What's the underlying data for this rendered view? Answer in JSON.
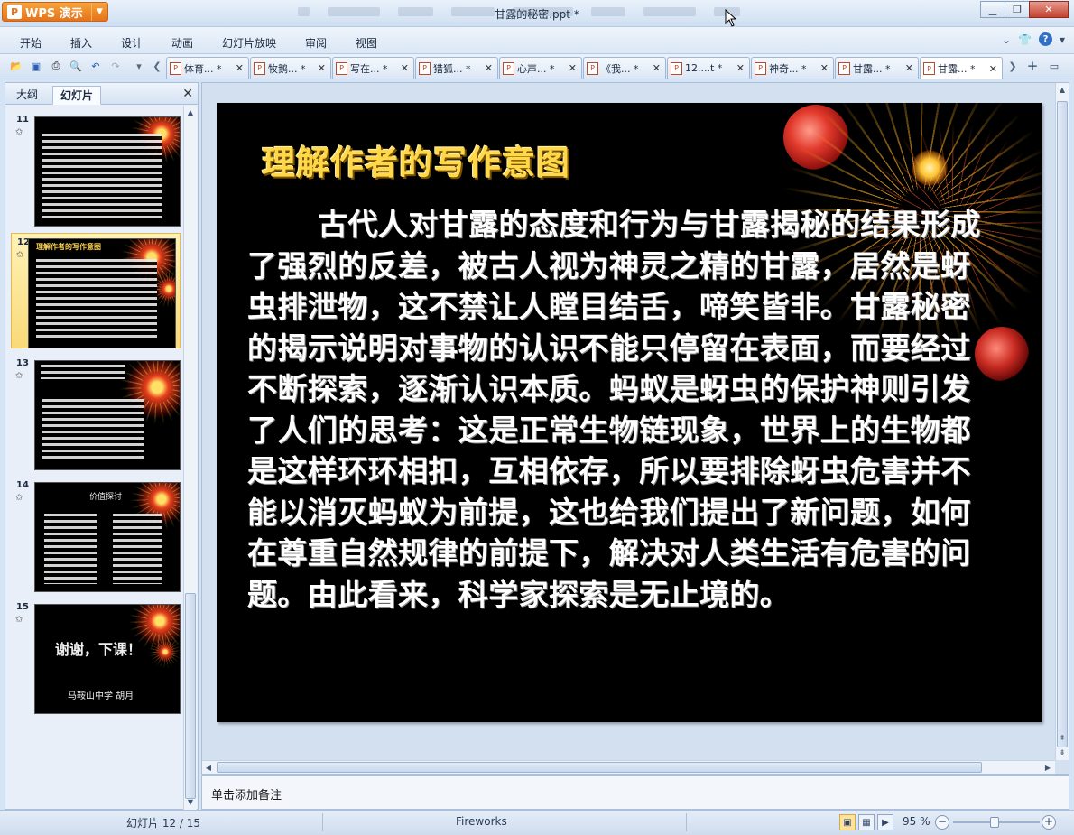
{
  "app": {
    "button_label": "WPS 演示",
    "window_title": "甘露的秘密.ppt *"
  },
  "menu": [
    {
      "label": "开始"
    },
    {
      "label": "插入"
    },
    {
      "label": "设计"
    },
    {
      "label": "动画"
    },
    {
      "label": "幻灯片放映"
    },
    {
      "label": "审阅"
    },
    {
      "label": "视图"
    }
  ],
  "tabs": [
    {
      "label": "体育... *",
      "active": false
    },
    {
      "label": "牧鹅... *",
      "active": false
    },
    {
      "label": "写在... *",
      "active": false
    },
    {
      "label": "猎狐... *",
      "active": false
    },
    {
      "label": "心声... *",
      "active": false
    },
    {
      "label": "《我... *",
      "active": false
    },
    {
      "label": "12....t *",
      "active": false
    },
    {
      "label": "神奇... *",
      "active": false
    },
    {
      "label": "甘露... *",
      "active": false
    },
    {
      "label": "甘露... *",
      "active": true
    }
  ],
  "left_panel": {
    "tabs": [
      {
        "label": "大纲",
        "active": false
      },
      {
        "label": "幻灯片",
        "active": true
      }
    ],
    "slides": [
      {
        "number": "11",
        "selected": false,
        "title": "",
        "labels": []
      },
      {
        "number": "12",
        "selected": true,
        "title": "理解作者的写作意图",
        "labels": []
      },
      {
        "number": "13",
        "selected": false,
        "title": "",
        "labels": []
      },
      {
        "number": "14",
        "selected": false,
        "title": "价值探讨",
        "labels": []
      },
      {
        "number": "15",
        "selected": false,
        "title": "谢谢，下课！",
        "labels": [
          "马鞍山中学 胡月"
        ]
      }
    ]
  },
  "slide": {
    "title": "理解作者的写作意图",
    "body": "古代人对甘露的态度和行为与甘露揭秘的结果形成了强烈的反差，被古人视为神灵之精的甘露，居然是蚜虫排泄物，这不禁让人瞠目结舌，啼笑皆非。甘露秘密的揭示说明对事物的认识不能只停留在表面，而要经过不断探索，逐渐认识本质。蚂蚁是蚜虫的保护神则引发了人们的思考：这是正常生物链现象，世界上的生物都是这样环环相扣，互相依存，所以要排除蚜虫危害并不能以消灭蚂蚁为前提，这也给我们提出了新问题，如何在尊重自然规律的前提下，解决对人类生活有危害的问题。由此看来，科学家探索是无止境的。",
    "title_color": "#ffd84a",
    "body_color": "#ffffff",
    "background": "#000000"
  },
  "notes": {
    "placeholder": "单击添加备注"
  },
  "status": {
    "slide_indicator": "幻灯片 12 / 15",
    "theme": "Fireworks",
    "zoom": "95 %",
    "zoom_value": 95
  },
  "colors": {
    "accent": "#e5731a",
    "selected_thumb": "#f9d978"
  }
}
